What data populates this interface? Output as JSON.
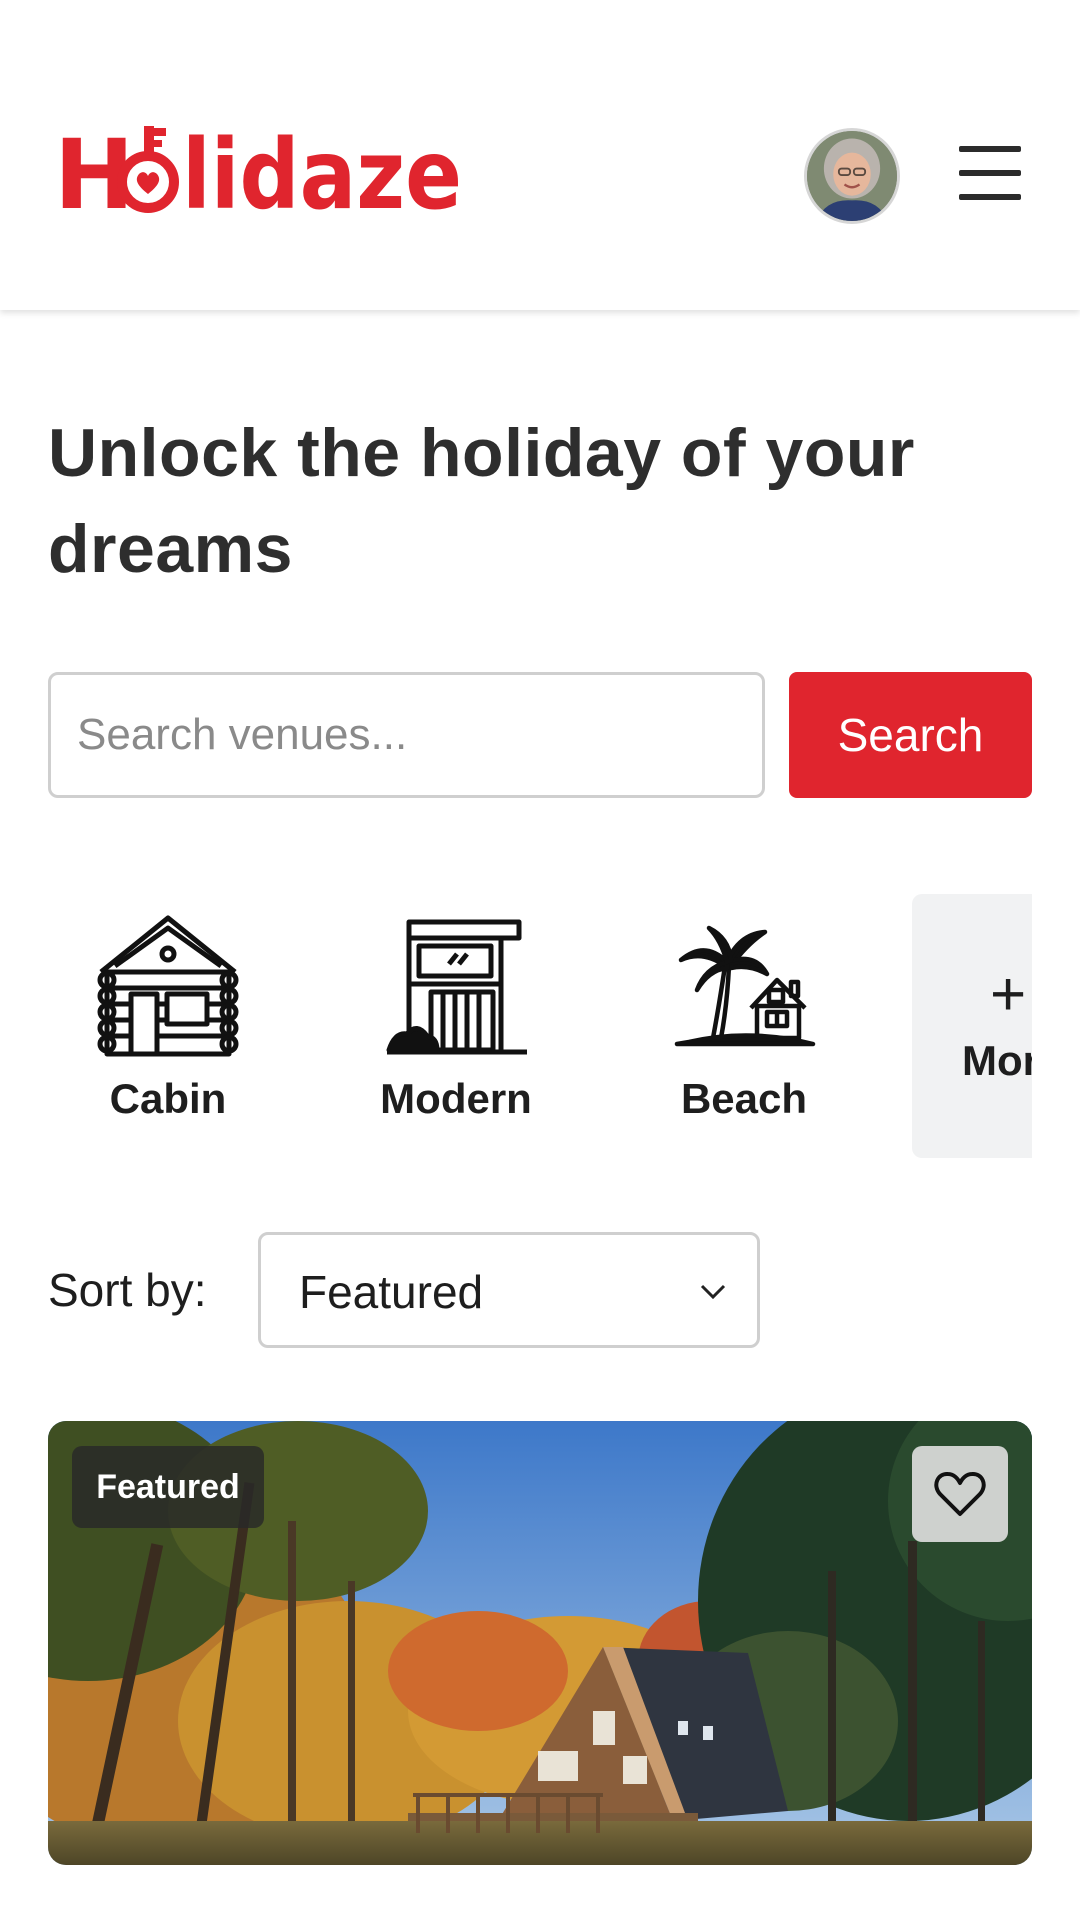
{
  "header": {
    "logo_text": "Holidaze",
    "brand_color": "#e0252e",
    "avatar_icon": "user-avatar",
    "menu_icon": "hamburger-menu-icon"
  },
  "hero": {
    "headline": "Unlock the holiday of your dreams"
  },
  "search": {
    "placeholder": "Search venues...",
    "value": "",
    "button_label": "Search"
  },
  "categories": {
    "items": [
      {
        "label": "Cabin",
        "icon": "cabin-icon"
      },
      {
        "label": "Modern",
        "icon": "modern-house-icon"
      },
      {
        "label": "Beach",
        "icon": "beach-house-icon"
      }
    ],
    "more": {
      "symbol": "+",
      "label": "More"
    }
  },
  "sort": {
    "label": "Sort by:",
    "selected": "Featured"
  },
  "listing": {
    "badge": "Featured",
    "favorite_icon": "heart-icon"
  }
}
